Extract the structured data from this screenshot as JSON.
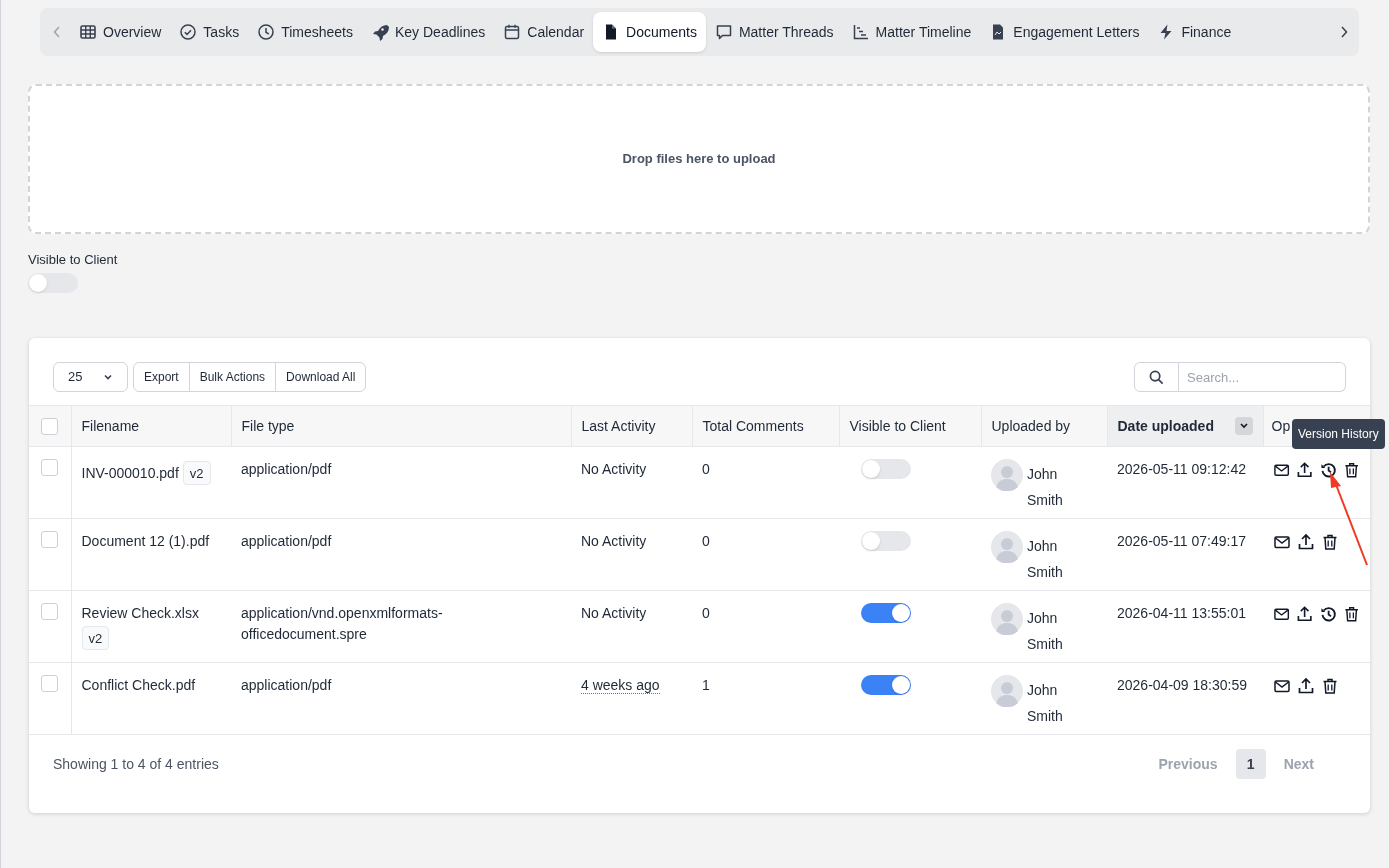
{
  "tabs": [
    {
      "label": "Overview",
      "kind": "grid",
      "selected": false
    },
    {
      "label": "Tasks",
      "kind": "check",
      "selected": false
    },
    {
      "label": "Timesheets",
      "kind": "clock",
      "selected": false
    },
    {
      "label": "Key Deadlines",
      "kind": "rocket",
      "selected": false
    },
    {
      "label": "Calendar",
      "kind": "calendar",
      "selected": false
    },
    {
      "label": "Documents",
      "kind": "file",
      "selected": true
    },
    {
      "label": "Matter Threads",
      "kind": "chat",
      "selected": false
    },
    {
      "label": "Matter Timeline",
      "kind": "timeline",
      "selected": false
    },
    {
      "label": "Engagement Letters",
      "kind": "letter",
      "selected": false
    },
    {
      "label": "Finance",
      "kind": "bolt",
      "selected": false
    }
  ],
  "dropzone": {
    "text": "Drop files here to upload"
  },
  "visible_toggle": {
    "label": "Visible to Client",
    "on": false
  },
  "toolbar": {
    "page_size": "25",
    "buttons": [
      "Export",
      "Bulk Actions",
      "Download All"
    ],
    "search_placeholder": "Search..."
  },
  "table": {
    "select_all": {
      "checked": false
    },
    "columns": [
      {
        "label": "Filename",
        "sorted": false
      },
      {
        "label": "File type",
        "sorted": false
      },
      {
        "label": "Last Activity",
        "sorted": false
      },
      {
        "label": "Total Comments",
        "sorted": false
      },
      {
        "label": "Visible to Client",
        "sorted": false
      },
      {
        "label": "Uploaded by",
        "sorted": false
      },
      {
        "label": "Date uploaded",
        "sorted": true
      },
      {
        "label": "Op",
        "sorted": false
      }
    ],
    "rows": [
      {
        "checked": false,
        "filename": "INV-000010.pdf",
        "version": "v2",
        "file_type": "application/pdf",
        "last_activity": "No Activity",
        "activity_dotted": false,
        "comments": "0",
        "visible": false,
        "uploaded_by": "John Smith",
        "date": "2026-05-11 09:12:42",
        "actions": [
          {
            "kind": "email"
          },
          {
            "kind": "upload"
          },
          {
            "kind": "history"
          },
          {
            "kind": "delete"
          }
        ]
      },
      {
        "checked": false,
        "filename": "Document 12 (1).pdf",
        "file_type": "application/pdf",
        "last_activity": "No Activity",
        "activity_dotted": false,
        "comments": "0",
        "visible": false,
        "uploaded_by": "John Smith",
        "date": "2026-05-11 07:49:17",
        "actions": [
          {
            "kind": "email"
          },
          {
            "kind": "upload"
          },
          {
            "kind": "delete"
          }
        ]
      },
      {
        "checked": false,
        "filename": "Review Check.xlsx",
        "version": "v2",
        "file_type": "application/vnd.openxmlformats-officedocument.spre",
        "last_activity": "No Activity",
        "activity_dotted": false,
        "comments": "0",
        "visible": true,
        "uploaded_by": "John Smith",
        "date": "2026-04-11 13:55:01",
        "actions": [
          {
            "kind": "email"
          },
          {
            "kind": "upload"
          },
          {
            "kind": "history"
          },
          {
            "kind": "delete"
          }
        ]
      },
      {
        "checked": false,
        "filename": "Conflict Check.pdf",
        "file_type": "application/pdf",
        "last_activity": "4 weeks ago",
        "activity_dotted": true,
        "comments": "1",
        "visible": true,
        "uploaded_by": "John Smith",
        "date": "2026-04-09 18:30:59",
        "actions": [
          {
            "kind": "email"
          },
          {
            "kind": "upload"
          },
          {
            "kind": "delete"
          }
        ]
      }
    ]
  },
  "tooltip": {
    "text": "Version History"
  },
  "footer": {
    "info": "Showing 1 to 4 of 4 entries",
    "pages": [
      {
        "label": "Previous",
        "kind": "prev",
        "disabled": true
      },
      {
        "label": "1",
        "kind": "page",
        "selected": true
      },
      {
        "label": "Next",
        "kind": "next",
        "disabled": true
      }
    ]
  }
}
